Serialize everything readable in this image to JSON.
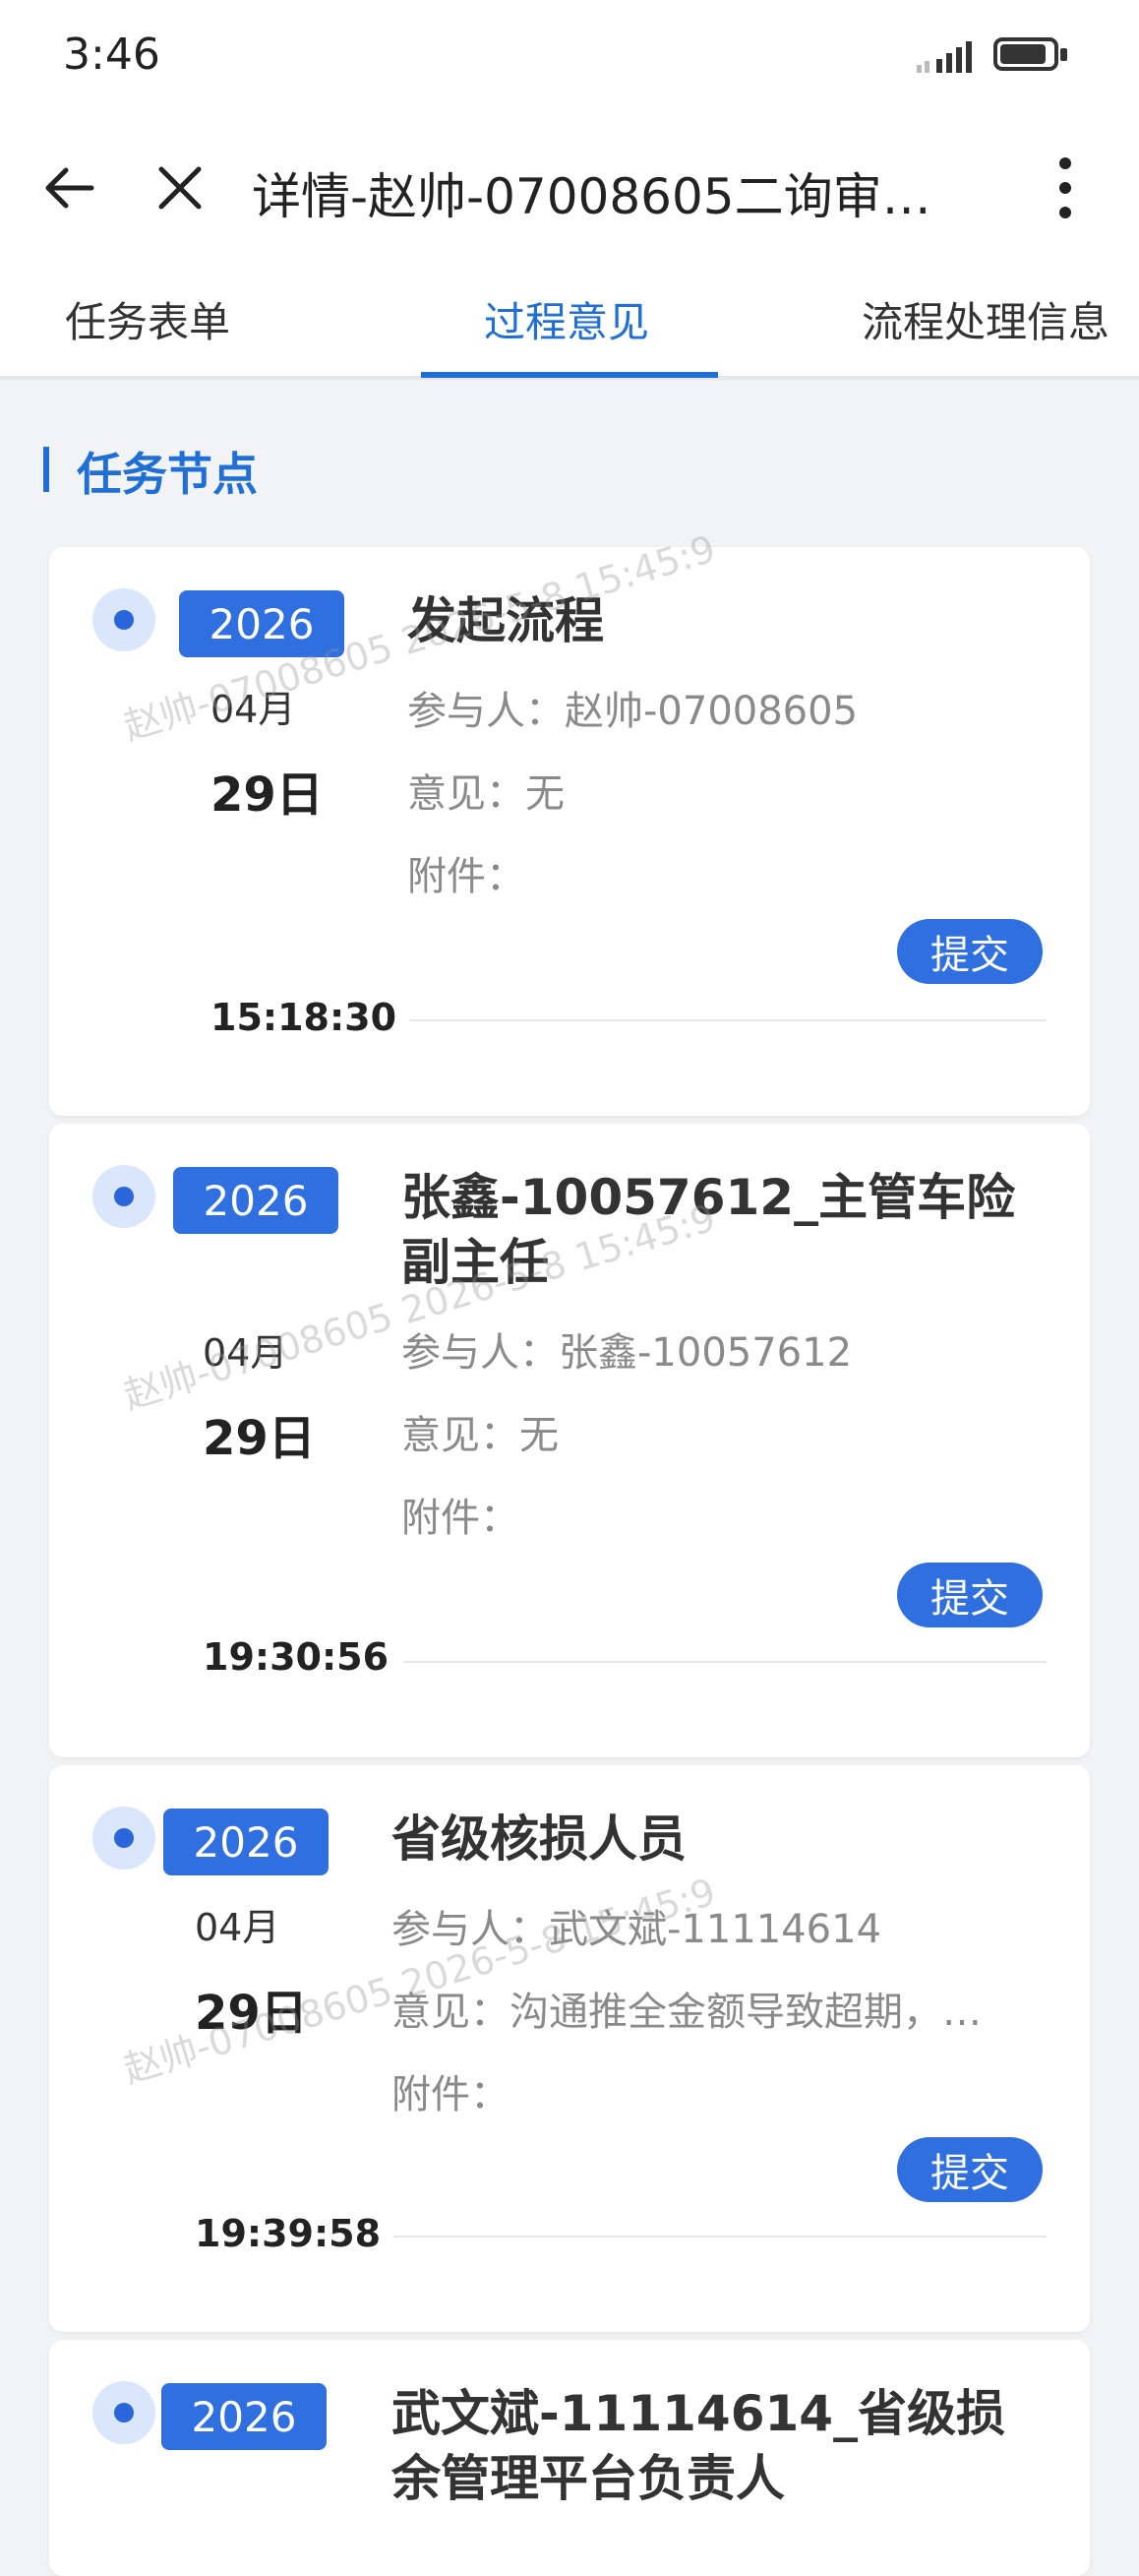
{
  "status_bar": {
    "time": "3:46"
  },
  "header": {
    "title": "详情-赵帅-07008605二询审…"
  },
  "tabs": [
    {
      "label": "任务表单"
    },
    {
      "label": "过程意见"
    },
    {
      "label": "流程处理信息"
    }
  ],
  "section": {
    "title": "任务节点"
  },
  "watermark": {
    "text": "赵帅-07008605 2026-5-8 15:45:9"
  },
  "labels": {
    "participant": "参与人：",
    "opinion": "意见：",
    "attachment": "附件：",
    "submit": "提交"
  },
  "nodes": [
    {
      "year": "2026",
      "month": "04月",
      "day": "29日",
      "time": "15:18:30",
      "title": "发起流程",
      "participant": "赵帅-07008605",
      "opinion": "无",
      "action": "提交"
    },
    {
      "year": "2026",
      "month": "04月",
      "day": "29日",
      "time": "19:30:56",
      "title": "张鑫-10057612_主管车险副主任",
      "participant": "张鑫-10057612",
      "opinion": "无",
      "action": "提交"
    },
    {
      "year": "2026",
      "month": "04月",
      "day": "29日",
      "time": "19:39:58",
      "title": "省级核损人员",
      "participant": "武文斌-11114614",
      "opinion": "沟通推全金额导致超期，…",
      "action": "提交"
    },
    {
      "year": "2026",
      "title": "武文斌-11114614_省级损余管理平台负责人"
    }
  ]
}
